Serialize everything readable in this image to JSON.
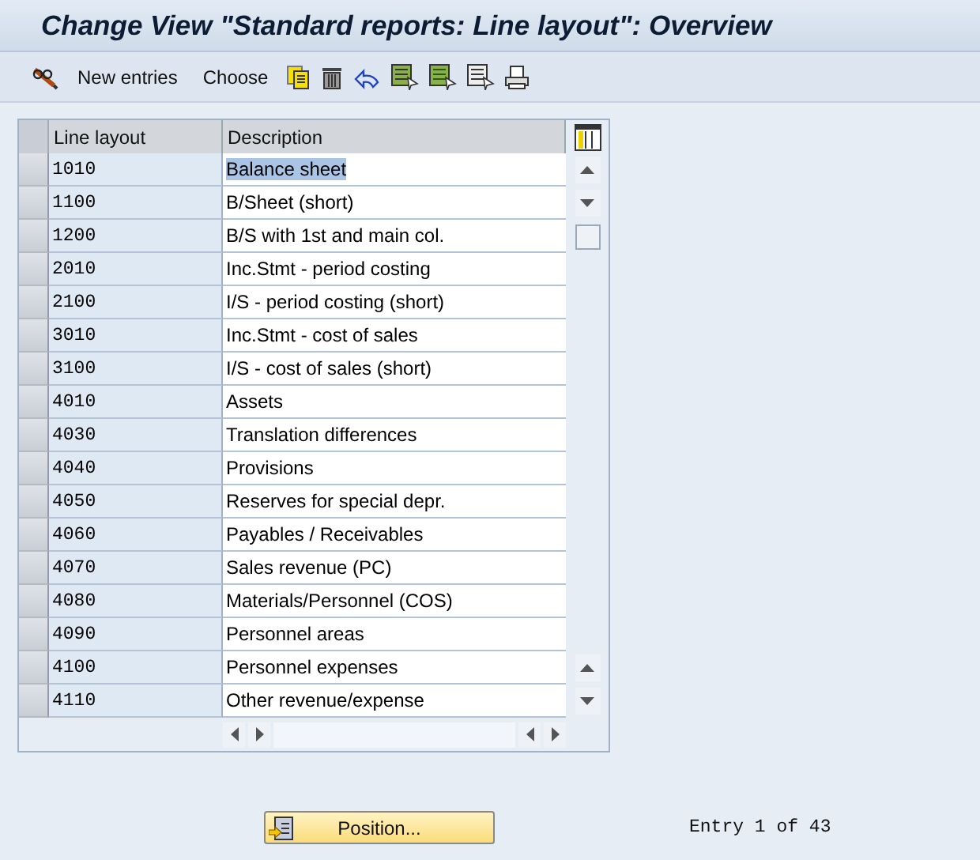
{
  "window": {
    "title": "Change View \"Standard reports: Line layout\": Overview"
  },
  "toolbar": {
    "buttons": [
      {
        "kind": "glasses"
      },
      {
        "kind": "text",
        "label": "New entries"
      },
      {
        "kind": "text",
        "label": "Choose"
      },
      {
        "kind": "copy"
      },
      {
        "kind": "delete"
      },
      {
        "kind": "undo"
      },
      {
        "kind": "select-all"
      },
      {
        "kind": "select-block"
      },
      {
        "kind": "deselect"
      },
      {
        "kind": "print"
      }
    ]
  },
  "table": {
    "columns": [
      "Line layout",
      "Description"
    ],
    "rows": [
      {
        "code": "1010",
        "description": "Balance sheet",
        "selected": true
      },
      {
        "code": "1100",
        "description": "B/Sheet (short)",
        "selected": false
      },
      {
        "code": "1200",
        "description": "B/S with 1st and main col.",
        "selected": false
      },
      {
        "code": "2010",
        "description": "Inc.Stmt - period costing",
        "selected": false
      },
      {
        "code": "2100",
        "description": "I/S - period costing (short)",
        "selected": false
      },
      {
        "code": "3010",
        "description": "Inc.Stmt - cost of sales",
        "selected": false
      },
      {
        "code": "3100",
        "description": "I/S - cost of sales (short)",
        "selected": false
      },
      {
        "code": "4010",
        "description": "Assets",
        "selected": false
      },
      {
        "code": "4030",
        "description": "Translation differences",
        "selected": false
      },
      {
        "code": "4040",
        "description": "Provisions",
        "selected": false
      },
      {
        "code": "4050",
        "description": "Reserves for special depr.",
        "selected": false
      },
      {
        "code": "4060",
        "description": "Payables / Receivables",
        "selected": false
      },
      {
        "code": "4070",
        "description": "Sales revenue (PC)",
        "selected": false
      },
      {
        "code": "4080",
        "description": "Materials/Personnel (COS)",
        "selected": false
      },
      {
        "code": "4090",
        "description": "Personnel areas",
        "selected": false
      },
      {
        "code": "4100",
        "description": "Personnel expenses",
        "selected": false
      },
      {
        "code": "4110",
        "description": "Other revenue/expense",
        "selected": false
      }
    ]
  },
  "footer": {
    "button": "Position...",
    "entry": "Entry 1 of 43"
  }
}
